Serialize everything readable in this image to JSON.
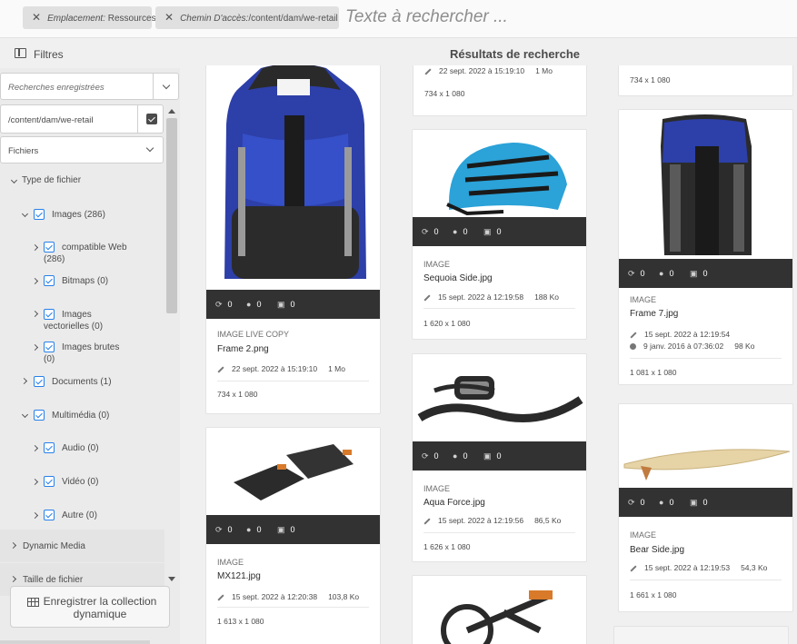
{
  "topbar": {
    "tags": [
      {
        "key": "Emplacement:",
        "value": "Ressources"
      },
      {
        "key": "Chemin D'accès:",
        "value": "/content/dam/we-retail"
      }
    ],
    "search_placeholder": "Texte à rechercher ..."
  },
  "rail": {
    "filters_label": "Filtres",
    "saved_searches": "Recherches enregistrées",
    "path": "/content/dam/we-retail",
    "files_select": "Fichiers",
    "tree": {
      "file_type": "Type de fichier",
      "images": "Images (286)",
      "web_compatible": [
        "compatible Web",
        "(286)"
      ],
      "bitmaps": "Bitmaps (0)",
      "vector": [
        "Images",
        "vectorielles (0)"
      ],
      "raw": [
        "Images brutes",
        "(0)"
      ],
      "documents": "Documents (1)",
      "multimedia": "Multimédia (0)",
      "audio": "Audio (0)",
      "video": "Vidéo (0)",
      "other": "Autre (0)"
    },
    "dynamic_media": "Dynamic Media",
    "file_size": "Taille de fichier",
    "save_button": [
      "Enregistrer la collection",
      "dynamique"
    ]
  },
  "results": {
    "title": "Résultats de recherche",
    "cards": [
      {
        "type": "IMAGE LIVE COPY",
        "name": "Frame 2.png",
        "modified": "22 sept. 2022 à 15:19:10",
        "size": "1 Mo",
        "dims": "734 x 1 080",
        "stats": [
          "0",
          "0",
          "0"
        ]
      },
      {
        "type": "IMAGE",
        "name": "MX121.jpg",
        "modified": "15 sept. 2022 à 12:20:38",
        "size": "103,8 Ko",
        "dims": "1 613 x 1 080",
        "stats": [
          "0",
          "0",
          "0"
        ]
      },
      {
        "type": "",
        "name": "",
        "modified": "22 sept. 2022 à 15:19:10",
        "size": "1 Mo",
        "dims": "734 x 1 080"
      },
      {
        "type": "IMAGE",
        "name": "Sequoia Side.jpg",
        "modified": "15 sept. 2022 à 12:19:58",
        "size": "188 Ko",
        "dims": "1 620 x 1 080",
        "stats": [
          "0",
          "0",
          "0"
        ]
      },
      {
        "type": "IMAGE",
        "name": "Aqua Force.jpg",
        "modified": "15 sept. 2022 à 12:19:56",
        "size": "86,5 Ko",
        "dims": "1 626 x 1 080",
        "stats": [
          "0",
          "0",
          "0"
        ]
      },
      {
        "type": "",
        "name": "",
        "modified": "",
        "size": "",
        "dims": "734 x 1 080"
      },
      {
        "type": "IMAGE",
        "name": "Frame 7.jpg",
        "modified": "15 sept. 2022 à 12:19:54",
        "created": "9 janv. 2016 à 07:36:02",
        "size": "98 Ko",
        "dims": "1 081 x 1 080",
        "stats": [
          "0",
          "0",
          "0"
        ]
      },
      {
        "type": "IMAGE",
        "name": "Bear Side.jpg",
        "modified": "15 sept. 2022 à 12:19:53",
        "size": "54,3 Ko",
        "dims": "1 661 x 1 080",
        "stats": [
          "0",
          "0",
          "0"
        ]
      }
    ]
  },
  "icons": {
    "sync": "sync-icon",
    "users": "users-icon",
    "comment": "comment-icon",
    "edit": "pencil-icon",
    "globe": "globe-icon",
    "collection": "collection-icon"
  }
}
